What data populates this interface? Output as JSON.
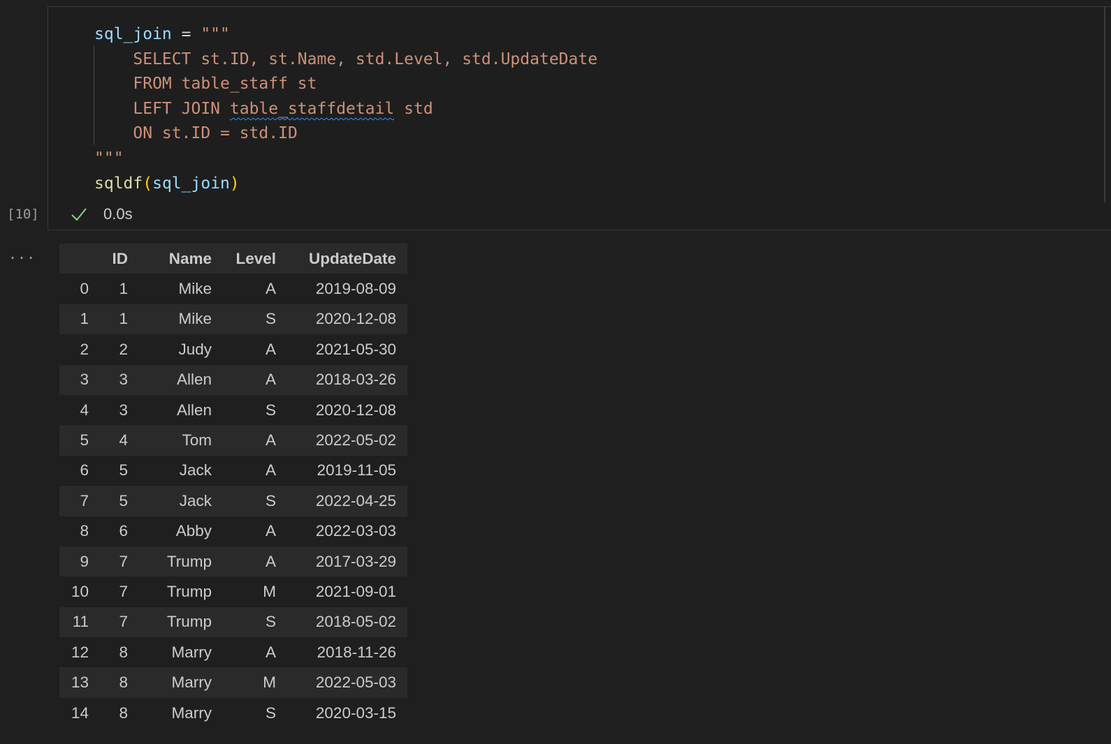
{
  "cell": {
    "execution_count": "[10]",
    "status_icon": "check-icon",
    "duration": "0.0s",
    "output_more": "..."
  },
  "code": {
    "var_name": "sql_join",
    "assign": " = ",
    "triple_quote": "\"\"\"",
    "sql_lines": [
      "SELECT st.ID, st.Name, std.Level, std.UpdateDate",
      "FROM table_staff st",
      "LEFT JOIN ",
      "ON st.ID = std.ID"
    ],
    "sql_squiggle_word": "table_staffdetail",
    "sql_line3_suffix": " std",
    "call_fn": "sqldf",
    "call_open": "(",
    "call_arg": "sql_join",
    "call_close": ")"
  },
  "table": {
    "headers": [
      "",
      "ID",
      "Name",
      "Level",
      "UpdateDate"
    ],
    "rows": [
      [
        "0",
        "1",
        "Mike",
        "A",
        "2019-08-09"
      ],
      [
        "1",
        "1",
        "Mike",
        "S",
        "2020-12-08"
      ],
      [
        "2",
        "2",
        "Judy",
        "A",
        "2021-05-30"
      ],
      [
        "3",
        "3",
        "Allen",
        "A",
        "2018-03-26"
      ],
      [
        "4",
        "3",
        "Allen",
        "S",
        "2020-12-08"
      ],
      [
        "5",
        "4",
        "Tom",
        "A",
        "2022-05-02"
      ],
      [
        "6",
        "5",
        "Jack",
        "A",
        "2019-11-05"
      ],
      [
        "7",
        "5",
        "Jack",
        "S",
        "2022-04-25"
      ],
      [
        "8",
        "6",
        "Abby",
        "A",
        "2022-03-03"
      ],
      [
        "9",
        "7",
        "Trump",
        "A",
        "2017-03-29"
      ],
      [
        "10",
        "7",
        "Trump",
        "M",
        "2021-09-01"
      ],
      [
        "11",
        "7",
        "Trump",
        "S",
        "2018-05-02"
      ],
      [
        "12",
        "8",
        "Marry",
        "A",
        "2018-11-26"
      ],
      [
        "13",
        "8",
        "Marry",
        "M",
        "2022-05-03"
      ],
      [
        "14",
        "8",
        "Marry",
        "S",
        "2020-03-15"
      ]
    ]
  },
  "colors": {
    "background": "#1f1f1f",
    "string": "#ce9178",
    "variable": "#9cdcfe",
    "function": "#dcdcaa",
    "success": "#89d185"
  }
}
